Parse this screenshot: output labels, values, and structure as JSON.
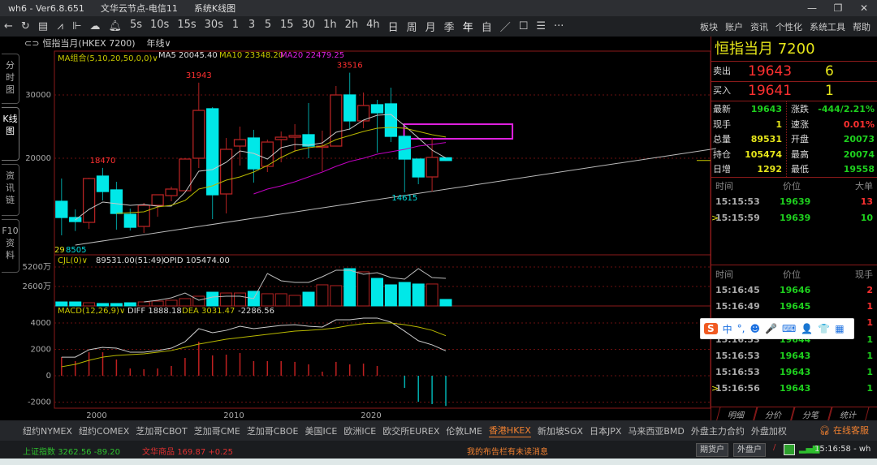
{
  "window": {
    "app": "wh6",
    "sep": "-",
    "version": "Ver6.8.651",
    "node": "文华云节点-电信11",
    "view": "系统K线图",
    "controls": [
      "—",
      "❐",
      "✕"
    ]
  },
  "toolbar": {
    "icons": [
      "back-arrow-icon",
      "refresh-icon",
      "table-icon",
      "line-chart-icon",
      "candlestick-icon",
      "cloud-icon",
      "bell-icon"
    ],
    "periods": [
      "5s",
      "10s",
      "15s",
      "30s",
      "1",
      "3",
      "5",
      "15",
      "30",
      "1h",
      "2h",
      "4h",
      "日",
      "周",
      "月",
      "季",
      "年",
      "自"
    ],
    "tools": [
      "／",
      "☐",
      "☰",
      "···"
    ],
    "menu": [
      "板块",
      "账户",
      "资讯",
      "个性化",
      "系统工具",
      "帮助"
    ]
  },
  "chart_header": {
    "instrument": "恒指当月(HKEX 7200)",
    "period": "年线∨"
  },
  "left_nav": [
    "分时图",
    "K线图",
    "资讯链",
    "F10资料"
  ],
  "indicators": {
    "ma_label": "MA组合(5,10,20,50,0,0)∨",
    "ma5": "MA5 20045.40",
    "ma10": "MA10 23348.20",
    "ma20": "MA20 22479.25",
    "vol_label": "CJL(0)∨",
    "vol_value": "89531.00(51:49)",
    "opid": "OPID 105474.00",
    "macd_label": "MACD(12,26,9)∨",
    "diff": "DIFF 1888.18",
    "dea": "DEA 3031.47",
    "macd": "-2286.56"
  },
  "colors": {
    "up": "#b22222",
    "down": "#00e8e8",
    "ma5": "#c8c8c8",
    "ma10": "#b8b800",
    "ma20": "#c000c0",
    "grid": "#6a1010",
    "box": "#e020e0"
  },
  "chart_data": {
    "type": "candlestick",
    "price_ticks": [
      30000,
      20000
    ],
    "x_ticks": [
      2000,
      2010,
      2020
    ],
    "annotations": {
      "high_labels": [
        {
          "year": 2000,
          "value": "18470"
        },
        {
          "year": 2007,
          "value": "31943"
        },
        {
          "year": 2018,
          "value": "33516"
        }
      ],
      "low_label": {
        "year": 2022,
        "value": "14615"
      },
      "corner_labels": [
        "29",
        "8505"
      ]
    },
    "candles": [
      [
        1997,
        13200,
        16800,
        7820,
        10640
      ],
      [
        1998,
        10640,
        11920,
        8505,
        10000
      ],
      [
        1999,
        9870,
        16920,
        8850,
        16800
      ],
      [
        2000,
        17180,
        18470,
        13330,
        14740
      ],
      [
        2001,
        15000,
        16280,
        8720,
        11280
      ],
      [
        2002,
        11150,
        12050,
        8590,
        9100
      ],
      [
        2003,
        9230,
        12950,
        8200,
        12560
      ],
      [
        2004,
        12560,
        14230,
        10770,
        14230
      ],
      [
        2005,
        14100,
        15510,
        13200,
        15130
      ],
      [
        2006,
        14870,
        20000,
        14870,
        19870
      ],
      [
        2007,
        20000,
        31943,
        18460,
        27560
      ],
      [
        2008,
        27820,
        28080,
        10380,
        14230
      ],
      [
        2009,
        14360,
        23200,
        11280,
        21410
      ],
      [
        2010,
        21920,
        25000,
        18850,
        22950
      ],
      [
        2011,
        23200,
        24490,
        16150,
        18330
      ],
      [
        2012,
        18720,
        22950,
        17820,
        22560
      ],
      [
        2013,
        22950,
        24230,
        19360,
        23330
      ],
      [
        2014,
        23330,
        25380,
        21030,
        23590
      ],
      [
        2015,
        23720,
        28720,
        20000,
        21920
      ],
      [
        2016,
        21800,
        24360,
        17950,
        21920
      ],
      [
        2017,
        21920,
        31410,
        21920,
        30000
      ],
      [
        2018,
        30000,
        33516,
        24490,
        25900
      ],
      [
        2019,
        25900,
        30380,
        24740,
        28330
      ],
      [
        2020,
        28460,
        29230,
        20900,
        27180
      ],
      [
        2021,
        28590,
        31150,
        22560,
        23460
      ],
      [
        2022,
        23460,
        23460,
        14615,
        19870
      ],
      [
        2023,
        19870,
        19870,
        15900,
        17050
      ],
      [
        2024,
        17050,
        23200,
        14740,
        20130
      ],
      [
        2025,
        20073,
        20074,
        19558,
        19643
      ]
    ],
    "ma5": {
      "start": 1998,
      "values": [
        10260,
        11920,
        13080,
        12820,
        12560,
        12690,
        12440,
        12440,
        14620,
        17950,
        18210,
        19360,
        21150,
        20770,
        19870,
        21670,
        22180,
        22050,
        22440,
        24100,
        24620,
        26030,
        26790,
        26920,
        25130,
        23210,
        21280,
        20045
      ]
    },
    "ma10": {
      "start": 2001,
      "values": [
        11280,
        11410,
        11540,
        12310,
        12560,
        13330,
        15130,
        15640,
        16540,
        17050,
        17820,
        18850,
        20130,
        21150,
        21670,
        21920,
        22950,
        23590,
        24230,
        24740,
        24870,
        24740,
        24230,
        23720,
        23348
      ]
    },
    "ma20": {
      "start": 2011,
      "values": [
        14360,
        15130,
        15640,
        16280,
        17050,
        17820,
        18720,
        19490,
        20000,
        20640,
        21030,
        21410,
        21920,
        22180,
        22479
      ]
    },
    "trendline": {
      "from": [
        1998,
        6280
      ],
      "to": [
        2044.7,
        21540
      ]
    },
    "box": {
      "from": [
        2022.4,
        25380
      ],
      "to": [
        2030.3,
        23080
      ]
    },
    "volume": {
      "unit": "万",
      "ticks": [
        "5200万",
        "2600万"
      ],
      "tick_values": [
        5200,
        2600
      ],
      "values": [
        540,
        540,
        430,
        330,
        330,
        430,
        540,
        650,
        760,
        980,
        1300,
        1840,
        1730,
        1730,
        1950,
        1630,
        1630,
        1410,
        1840,
        2820,
        2710,
        4980,
        4550,
        3680,
        2820,
        3140,
        2930,
        2930,
        870
      ],
      "ma": {
        "start": 2003,
        "values": [
          540,
          760,
          1080,
          1730,
          760,
          1190,
          1300,
          1300,
          980,
          4330,
          3360,
          3140,
          3140,
          3900,
          4770,
          4770,
          4220,
          4440,
          3790,
          3570,
          4980,
          3790,
          3680
        ]
      }
    },
    "macd": {
      "ticks": [
        4000,
        2000,
        0,
        -2000
      ],
      "hist": [
        1410,
        1110,
        1780,
        1780,
        1230,
        550,
        490,
        550,
        740,
        1350,
        2580,
        1540,
        1600,
        1720,
        1110,
        1110,
        1110,
        1050,
        860,
        310,
        1050,
        860,
        920,
        740,
        0,
        -920,
        -1970,
        -2150,
        -2287
      ],
      "diff": [
        1410,
        1410,
        1970,
        2150,
        2090,
        1780,
        1780,
        1910,
        2090,
        2580,
        3570,
        3260,
        3440,
        3750,
        3570,
        3690,
        3810,
        3870,
        3750,
        3690,
        4240,
        4240,
        4370,
        4370,
        4060,
        3380,
        2650,
        2340,
        1888
      ],
      "dea": [
        680,
        860,
        1170,
        1410,
        1540,
        1600,
        1660,
        1780,
        1910,
        2150,
        2400,
        2580,
        2770,
        2890,
        3010,
        3140,
        3260,
        3380,
        3440,
        3510,
        3630,
        3810,
        3940,
        4000,
        4000,
        3870,
        3690,
        3440,
        3031
      ]
    }
  },
  "quote": {
    "title": "恒指当月  7200",
    "sell": {
      "label": "卖出",
      "price": "19643",
      "qty": "6"
    },
    "buy": {
      "label": "买入",
      "price": "19641",
      "qty": "1"
    },
    "stats": [
      {
        "l": "最新",
        "v": "19643",
        "c": "g",
        "l2": "涨跌",
        "v2": "-444/2.21%",
        "c2": "g"
      },
      {
        "l": "现手",
        "v": "1",
        "c": "y",
        "l2": "速涨",
        "v2": "0.01%",
        "c2": "r"
      },
      {
        "l": "总量",
        "v": "89531",
        "c": "y",
        "l2": "开盘",
        "v2": "20073",
        "c2": "g"
      },
      {
        "l": "持仓",
        "v": "105474",
        "c": "y",
        "l2": "最高",
        "v2": "20074",
        "c2": "g"
      },
      {
        "l": "日增",
        "v": "1292",
        "c": "y",
        "l2": "最低",
        "v2": "19558",
        "c2": "g"
      }
    ],
    "big": {
      "headers": [
        "时间",
        "价位",
        "大单"
      ],
      "rows": [
        {
          "t": "15:15:53",
          "p": "19639",
          "q": "13",
          "qc": "r",
          "m": ""
        },
        {
          "t": "15:15:59",
          "p": "19639",
          "q": "10",
          "qc": "g",
          "m": ">"
        }
      ]
    },
    "ticks": {
      "headers": [
        "时间",
        "价位",
        "现手"
      ],
      "rows": [
        {
          "t": "15:16:45",
          "p": "19646",
          "q": "2",
          "qc": "r",
          "m": ""
        },
        {
          "t": "15:16:49",
          "p": "19645",
          "q": "1",
          "qc": "r",
          "m": ""
        },
        {
          "t": "15:16:49",
          "p": "19645",
          "q": "1",
          "qc": "r",
          "m": ""
        },
        {
          "t": "15:16:53",
          "p": "19644",
          "q": "1",
          "qc": "g",
          "m": ""
        },
        {
          "t": "15:16:53",
          "p": "19643",
          "q": "1",
          "qc": "g",
          "m": ""
        },
        {
          "t": "15:16:53",
          "p": "19643",
          "q": "1",
          "qc": "g",
          "m": ""
        },
        {
          "t": "15:16:56",
          "p": "19643",
          "q": "1",
          "qc": "g",
          "m": ">"
        }
      ]
    },
    "tabs": [
      "明细",
      "分价",
      "分笔",
      "统计"
    ]
  },
  "ime": {
    "logo": "S",
    "items": [
      "中",
      "°,",
      "☻",
      "🎤",
      "⌨",
      "👤",
      "👕",
      "▦"
    ]
  },
  "market_tabs": [
    "纽约NYMEX",
    "纽约COMEX",
    "芝加哥CBOT",
    "芝加哥CME",
    "芝加哥CBOE",
    "美国ICE",
    "欧洲ICE",
    "欧交所EUREX",
    "伦敦LME",
    "香港HKEX",
    "新加坡SGX",
    "日本JPX",
    "马来西亚BMD",
    "外盘主力合约",
    "外盘加权"
  ],
  "active_market": "香港HKEX",
  "support": "在线客服",
  "status": {
    "sh_label": "上证指数",
    "sh_value": "3262.56",
    "sh_change": "-89.20",
    "wh_label": "文华商品",
    "wh_value": "169.87",
    "wh_change": "+0.25",
    "message": "我的布告栏有未读消息",
    "btn1": "期货户",
    "btn2": "外盘户",
    "time": "15:16:58 - wh"
  }
}
